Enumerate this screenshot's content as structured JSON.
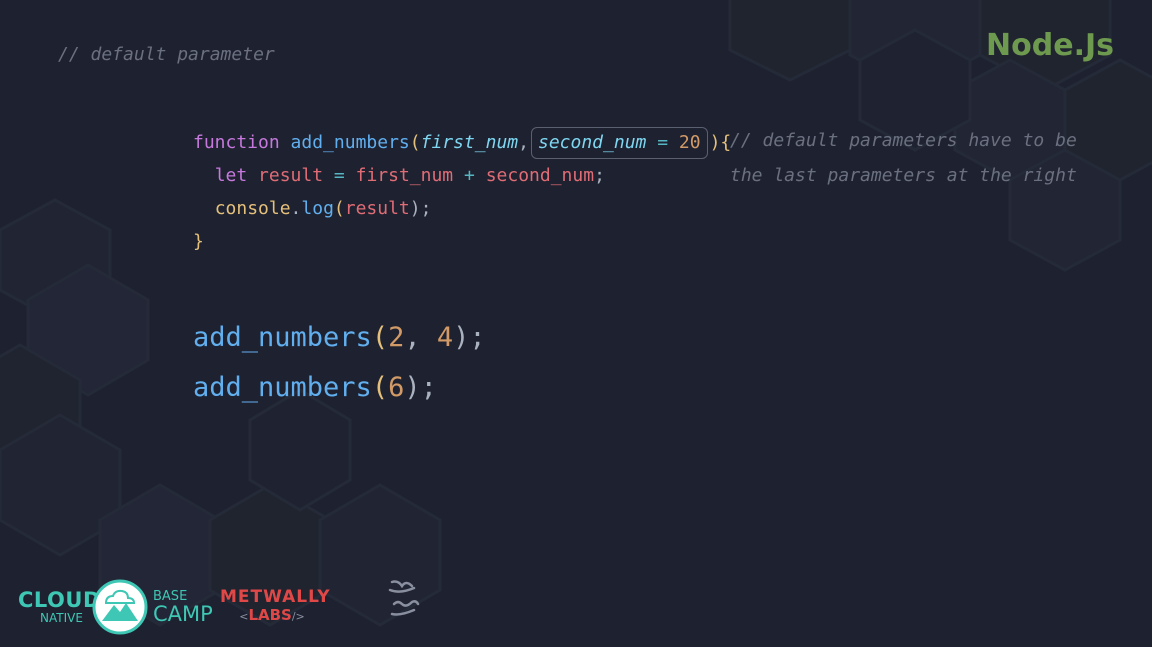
{
  "header": {
    "comment": "// default parameter",
    "brand": "Node.Js"
  },
  "code": {
    "line1": {
      "kw": "function",
      "name": "add_numbers",
      "open": "(",
      "param1": "first_num",
      "comma": ",",
      "param2": "second_num",
      "eq": "=",
      "default": "20",
      "close": "){"
    },
    "line2": {
      "kw": "let",
      "var": "result",
      "eq": "=",
      "a": "first_num",
      "plus": "+",
      "b": "second_num",
      "semi": ";"
    },
    "line3": {
      "obj": "console",
      "dot": ".",
      "method": "log",
      "open": "(",
      "arg": "result",
      "close": ");"
    },
    "line4": {
      "brace": "}"
    }
  },
  "side_comment": "// default parameters have to be the last parameters at the right",
  "calls": [
    {
      "name": "add_numbers",
      "open": "(",
      "args": [
        {
          "v": "2"
        },
        {
          "sep": ", "
        },
        {
          "v": "4"
        }
      ],
      "close": ");"
    },
    {
      "name": "add_numbers",
      "open": "(",
      "arg": "6",
      "close": ");"
    }
  ],
  "logos": {
    "cloud": "CLOUD",
    "native": "NATIVE",
    "base": "BASE",
    "camp": "CAMP",
    "metwally": "METWALLY",
    "labs": "LABS",
    "labs_open": "<",
    "labs_close": "/>",
    "signature": "احمد مدبولي"
  },
  "colors": {
    "background": "#1e2230",
    "brand": "#6e9a4f",
    "comment": "#6b7080",
    "keyword": "#c678dd",
    "function": "#61afef",
    "number": "#d19a66",
    "variable": "#e06c75",
    "cloud_accent": "#3ec7b4",
    "metwally_red": "#e04848"
  }
}
